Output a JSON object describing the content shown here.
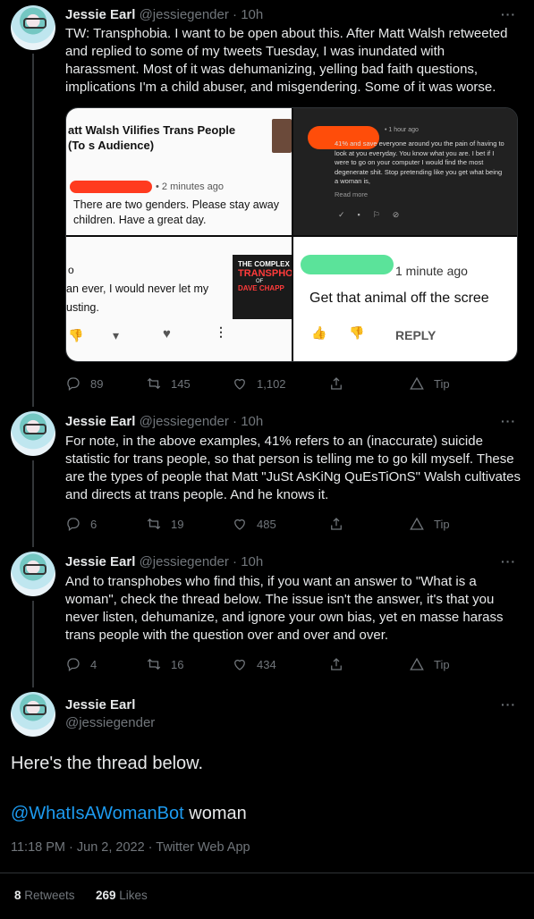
{
  "tweets": [
    {
      "name": "Jessie Earl",
      "handle": "@jessiegender",
      "time": "· 10h",
      "text": "TW: Transphobia. I want to be open about this. After Matt Walsh retweeted and replied to some of my tweets Tuesday, I was inundated with harassment. Most of it was dehumanizing, yelling bad faith questions, implications I'm a child abuser, and misgendering. Some of it was worse.",
      "replies": "89",
      "retweets": "145",
      "likes": "1,102",
      "tip": "Tip"
    },
    {
      "name": "Jessie Earl",
      "handle": "@jessiegender",
      "time": "· 10h",
      "text": "For note, in the above examples, 41% refers to an (inaccurate) suicide statistic for trans people, so that person is telling me to go kill myself. These are the types of people that Matt \"JuSt AsKiNg QuEsTiOnS\" Walsh cultivates and directs at trans people. And he knows it.",
      "replies": "6",
      "retweets": "19",
      "likes": "485",
      "tip": "Tip"
    },
    {
      "name": "Jessie Earl",
      "handle": "@jessiegender",
      "time": "· 10h",
      "text": "And to transphobes who find this, if you want an answer to \"What is a woman\", check the thread below. The issue isn't the answer, it's that you never listen, dehumanize, and ignore your own bias, yet en masse harass trans people with the question over and over and over.",
      "replies": "4",
      "retweets": "16",
      "likes": "434",
      "tip": "Tip"
    }
  ],
  "media": {
    "p1_title": "att Walsh Vilifies Trans People (To s Audience)",
    "p1_time": "• 2 minutes ago",
    "p1_comment": "There are two genders. Please stay away children. Have a great day.",
    "p2_time": "• 1 hour ago",
    "p2_comment": "41% and save everyone around you the pain of having to look at you everyday. You know what you are. I bet if I were to go on your computer I would find the most degenerate shit. Stop pretending like you get what being a woman is,",
    "p2_more": "Read more",
    "p3_line1": "o",
    "p3_comment": "an ever, I would never let my usting.",
    "p3_thumb1": "THE COMPLEX",
    "p3_thumb2": "TRANSPHO",
    "p3_thumb3": "OF",
    "p3_thumb4": "DAVE CHAPP",
    "p4_time": "1 minute ago",
    "p4_comment": "Get that animal off the scree",
    "p4_reply": "REPLY"
  },
  "main": {
    "name": "Jessie Earl",
    "handle": "@jessiegender",
    "text": "Here's the thread below.",
    "mention": "@WhatIsAWomanBot",
    "mention_after": " woman",
    "timestamp": "11:18 PM · Jun 2, 2022 · Twitter Web App",
    "retweets_count": "8",
    "retweets_label": " Retweets",
    "likes_count": "269",
    "likes_label": " Likes"
  },
  "colors": {
    "background": "#000000",
    "link": "#1d9bf0",
    "muted": "#71767b",
    "redaction_red": "#ff3b1f",
    "redaction_green": "#5be39a"
  }
}
